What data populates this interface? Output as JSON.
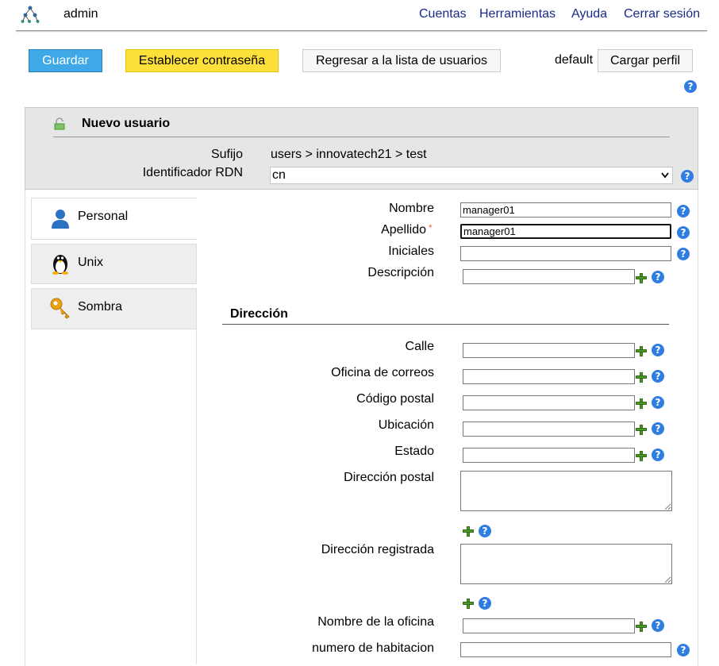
{
  "header": {
    "user": "admin",
    "nav": [
      "Cuentas",
      "Herramientas",
      "Ayuda",
      "Cerrar sesión"
    ]
  },
  "toolbar": {
    "save": "Guardar",
    "set_password": "Establecer contraseña",
    "back": "Regresar a la lista de usuarios",
    "profile_name": "default",
    "load_profile": "Cargar perfil"
  },
  "panel": {
    "title": "Nuevo usuario",
    "suffix_label": "Sufijo",
    "suffix_value": "users > innovatech21 > test",
    "rdn_label": "Identificador RDN",
    "rdn_value": "cn"
  },
  "tabs": [
    {
      "label": "Personal",
      "icon": "person-icon",
      "active": true
    },
    {
      "label": "Unix",
      "icon": "tux-penguin-icon",
      "active": false
    },
    {
      "label": "Sombra",
      "icon": "key-icon",
      "active": false
    }
  ],
  "form": {
    "nombre_label": "Nombre",
    "nombre_value": "manager01",
    "apellido_label": "Apellido",
    "apellido_value": "manager01",
    "required_mark": "*",
    "iniciales_label": "Iniciales",
    "descripcion_label": "Descripción",
    "section_title": "Dirección",
    "calle_label": "Calle",
    "oficina_correos_label": "Oficina de correos",
    "codigo_postal_label": "Código postal",
    "ubicacion_label": "Ubicación",
    "estado_label": "Estado",
    "direccion_postal_label": "Dirección postal",
    "direccion_registrada_label": "Dirección registrada",
    "nombre_oficina_label": "Nombre de la oficina",
    "numero_habitacion_label": "numero de habitacion"
  },
  "help_glyph": "?",
  "colors": {
    "save": "#3ea9e6",
    "set_password": "#fde03a",
    "nav_link": "#1a2a8c",
    "help": "#2f7de1",
    "add": "#4e9a28"
  }
}
